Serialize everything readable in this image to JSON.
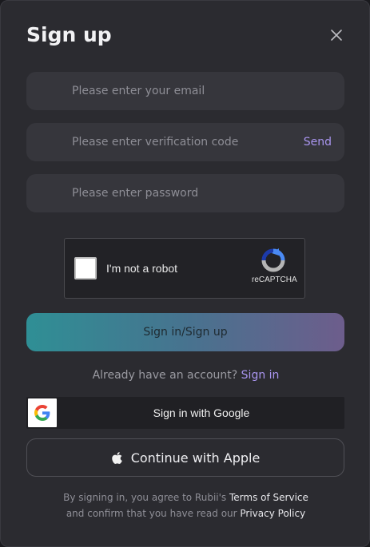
{
  "modal": {
    "title": "Sign up"
  },
  "form": {
    "email_placeholder": "Please enter your email",
    "code_placeholder": "Please enter verification code",
    "send_label": "Send",
    "password_placeholder": "Please enter password"
  },
  "captcha": {
    "label": "I'm not a robot",
    "brand": "reCAPTCHA"
  },
  "primary_button": "Sign in/Sign up",
  "account": {
    "prompt": "Already have an account?",
    "link": "Sign in"
  },
  "google": {
    "label": "Sign in with Google"
  },
  "apple": {
    "label": "Continue with Apple"
  },
  "legal": {
    "line1_prefix": "By signing in, you agree to Rubii's ",
    "terms": "Terms of Service",
    "line2_prefix": "and confirm that you have read our ",
    "privacy": "Privacy Policy"
  },
  "colors": {
    "accent": "#a995ef",
    "background": "#2b2b30",
    "field": "#36363c"
  }
}
